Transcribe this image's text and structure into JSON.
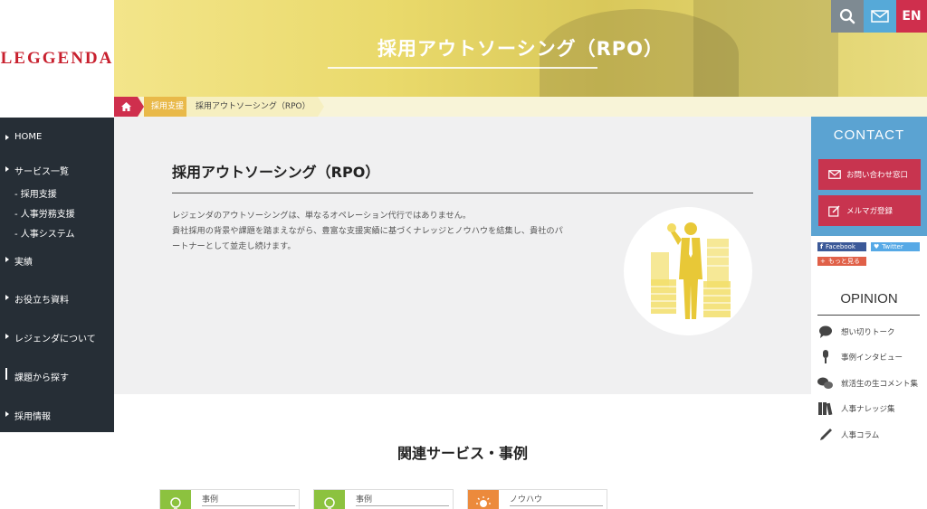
{
  "logo": {
    "text": "LEGGENDA"
  },
  "hero": {
    "title": "採用アウトソーシング（RPO）"
  },
  "top_buttons": {
    "search_icon": "search-icon",
    "mail_icon": "mail-icon",
    "lang": "EN"
  },
  "breadcrumb": {
    "home_icon": "home-icon",
    "item1": "採用支援",
    "item2": "採用アウトソーシング（RPO）"
  },
  "leftnav": {
    "home": "HOME",
    "services": "サービス一覧",
    "sub1": "- 採用支援",
    "sub2": "- 人事労務支援",
    "sub3": "- 人事システム",
    "results": "実績",
    "resources": "お役立ち資料",
    "about": "レジェンダについて",
    "issues": "課題から探す",
    "recruit": "採用情報"
  },
  "main": {
    "title": "採用アウトソーシング（RPO）",
    "line1": "レジェンダのアウトソーシングは、単なるオペレーション代行ではありません。",
    "line2": "貴社採用の背景や課題を踏まえながら、豊富な支援実績に基づくナレッジとノウハウを結集し、貴社のパ",
    "line3": "ートナーとして並走し続けます。"
  },
  "related": {
    "title": "関連サービス・事例",
    "cards": [
      {
        "label": "事例",
        "color": "#8cc23f"
      },
      {
        "label": "事例",
        "color": "#8cc23f"
      },
      {
        "label": "ノウハウ",
        "color": "#ec8a3c"
      }
    ]
  },
  "contact": {
    "title": "CONTACT",
    "inquiry": "お問い合わせ窓口",
    "newsletter": "メルマガ登録"
  },
  "share": {
    "facebook": "Facebook",
    "twitter": "Twitter",
    "more": "もっと見る"
  },
  "opinion": {
    "title": "OPINION",
    "items": [
      {
        "label": "想い切りトーク",
        "icon": "speech-bubble-icon"
      },
      {
        "label": "事例インタビュー",
        "icon": "microphone-icon"
      },
      {
        "label": "就活生の生コメント集",
        "icon": "chat-bubbles-icon"
      },
      {
        "label": "人事ナレッジ集",
        "icon": "books-icon"
      },
      {
        "label": "人事コラム",
        "icon": "pen-icon"
      }
    ]
  },
  "colors": {
    "brand_red": "#c8202e",
    "nav_dark": "#262e36",
    "contact_blue": "#5ba3d2",
    "button_red": "#c8344f",
    "hero_yellow": "#f3e58a"
  }
}
